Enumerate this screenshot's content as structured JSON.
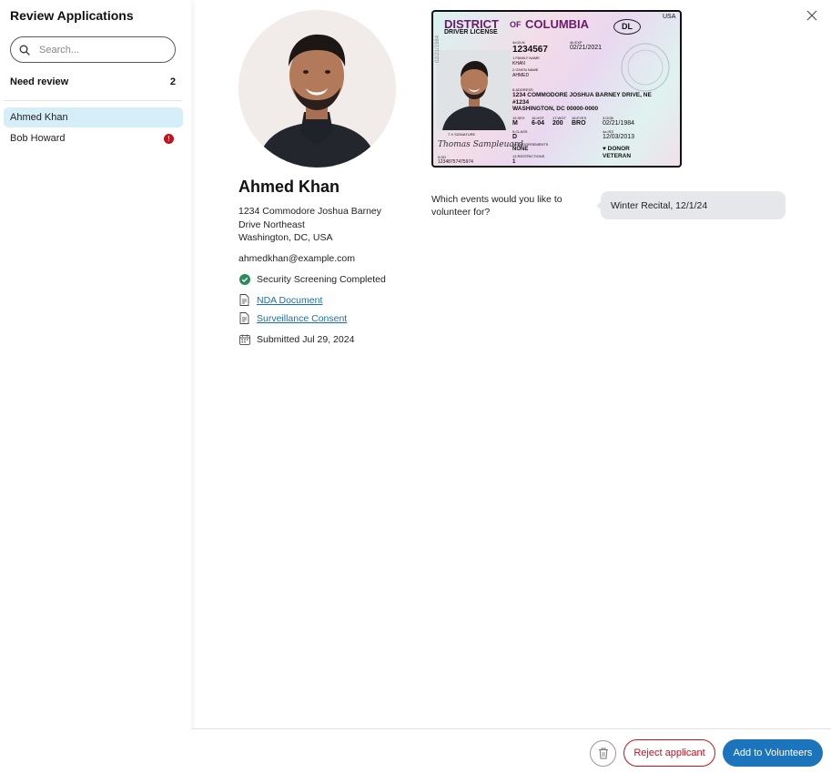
{
  "sidebar": {
    "title": "Review Applications",
    "search_placeholder": "Search...",
    "section_label": "Need review",
    "section_count": "2",
    "items": [
      {
        "label": "Ahmed Khan"
      },
      {
        "label": "Bob Howard",
        "alert": "!"
      }
    ]
  },
  "applicant": {
    "name": "Ahmed Khan",
    "address_line1": "1234 Commodore Joshua Barney",
    "address_line2": "Drive Northeast",
    "address_line3": "Washington, DC, USA",
    "email": "ahmedkhan@example.com",
    "screening": "Security Screening Completed",
    "nda_link": "NDA Document",
    "surveillance_link": "Surveillance Consent",
    "submitted": "Submitted Jul 29, 2024"
  },
  "id_card": {
    "district": "DISTRICT",
    "of": "OF",
    "columbia": "COLUMBIA",
    "usa": "USA",
    "dl_badge": "DL",
    "license_label": "DRIVER LICENSE",
    "dln_label": "4d.DLN",
    "dln": "1234567",
    "exp_label": "4b.EXP",
    "exp": "02/21/2021",
    "family_label": "1.FAMILY NAME",
    "family": "KHAN",
    "given_label": "2.GIVEN NAME",
    "given": "AHMED",
    "address_label": "8.ADDRESS",
    "address1": "1234 COMMODORE JOSHUA BARNEY DRIVE, NE",
    "address2": "#1234",
    "address3": "WASHINGTON, DC 00000-0000",
    "sex_label": "15.SEX",
    "sex": "M",
    "hgt_label": "16.HGT",
    "hgt": "6-04",
    "wgt_label": "17.WGT",
    "wgt": "200",
    "eyes_label": "18.EYES",
    "eyes": "BRO",
    "dob_label": "3.DOB",
    "dob": "02/21/1984",
    "class_label": "9.CLASS",
    "class": "D",
    "iss_label": "4a.ISS",
    "iss": "12/03/2013",
    "endorse_label": "9a.ENDORSEMENTS",
    "endorse": "NONE",
    "restrict_label": "12.RESTRICTIONS",
    "restrict": "1",
    "dd_label": "5.DD",
    "dd": "12348757475974",
    "donor": "DONOR",
    "veteran": "VETERAN",
    "signature": "Thomas Sampleuard",
    "sig_label": "7.X SIGNATURE",
    "side_text": "02/21/1984"
  },
  "question": {
    "text": "Which events would you like to volunteer for?",
    "answer": "Winter Recital, 12/1/24"
  },
  "footer": {
    "reject_label": "Reject applicant",
    "add_label": "Add to Volunteers"
  },
  "colors": {
    "accent": "#1c75bc",
    "danger": "#c1121f",
    "success": "#2e8b57",
    "link": "#1a70a8",
    "selected": "#d6eef8"
  }
}
